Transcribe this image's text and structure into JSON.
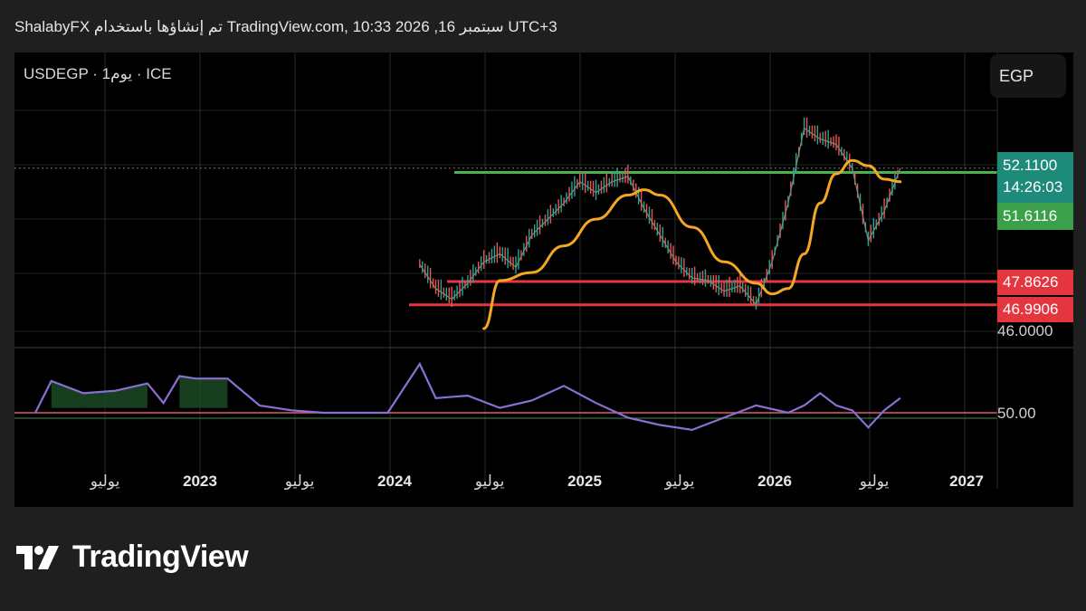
{
  "header": {
    "text": "ShalabyFX تم إنشاؤها باستخدام TradingView.com, 10:33 2026 ,16 سبتمبر UTC+3"
  },
  "symbol": {
    "text": "USDEGP · 1يوم · ICE"
  },
  "currency": {
    "label": "EGP"
  },
  "price_tags": {
    "last_price": "52.1100",
    "countdown": "14:26:03",
    "ma_value": "51.6116",
    "resistance_upper": "47.8626",
    "resistance_lower": "46.9906"
  },
  "axis": {
    "price_label_46": "46.0000",
    "osc_label_50": "50.00"
  },
  "x_ticks": [
    {
      "label": "يوليو",
      "year": false
    },
    {
      "label": "2023",
      "year": true
    },
    {
      "label": "يوليو",
      "year": false
    },
    {
      "label": "2024",
      "year": true
    },
    {
      "label": "يوليو",
      "year": false
    },
    {
      "label": "2025",
      "year": true
    },
    {
      "label": "يوليو",
      "year": false
    },
    {
      "label": "2026",
      "year": true
    },
    {
      "label": "يوليو",
      "year": false
    },
    {
      "label": "2027",
      "year": true
    }
  ],
  "brand": {
    "name": "TradingView"
  },
  "colors": {
    "up": "#26a69a",
    "down": "#ef5350",
    "ma": "#f5a623",
    "green_line": "#4caf50",
    "red_line": "#e4363f",
    "oscillator": "#8a6fd6"
  },
  "chart_data": {
    "type": "line",
    "symbol": "USDEGP",
    "timeframe": "1D",
    "x_ticks": [
      "يوليو",
      "2023",
      "يوليو",
      "2024",
      "يوليو",
      "2025",
      "يوليو",
      "2026",
      "يوليو",
      "2027"
    ],
    "price_series": {
      "x": [
        "2024-03",
        "2024-04",
        "2024-05",
        "2024-06",
        "2024-07",
        "2024-08",
        "2024-09",
        "2024-10",
        "2024-11",
        "2024-12",
        "2025-01",
        "2025-02",
        "2025-03",
        "2025-04",
        "2025-05",
        "2025-06",
        "2025-07",
        "2025-08",
        "2025-09",
        "2025-10",
        "2025-11",
        "2025-12",
        "2026-01",
        "2026-02",
        "2026-03",
        "2026-04",
        "2026-05",
        "2026-06",
        "2026-07",
        "2026-08",
        "2026-09"
      ],
      "values": [
        48.5,
        47.6,
        47.2,
        47.8,
        48.6,
        48.9,
        48.4,
        49.6,
        50.2,
        50.8,
        51.6,
        51.2,
        51.6,
        51.8,
        50.6,
        49.6,
        48.6,
        48.0,
        47.9,
        47.5,
        47.7,
        47.0,
        48.6,
        50.8,
        53.6,
        53.2,
        53.0,
        52.1,
        49.4,
        50.5,
        52.11
      ]
    },
    "moving_average": {
      "x": [
        "2024-07",
        "2024-08",
        "2024-10",
        "2024-12",
        "2025-02",
        "2025-04",
        "2025-05",
        "2025-06",
        "2025-08",
        "2025-10",
        "2025-12",
        "2026-01",
        "2026-02",
        "2026-03",
        "2026-04",
        "2026-05",
        "2026-06",
        "2026-07",
        "2026-08",
        "2026-09"
      ],
      "values": [
        46.1,
        47.9,
        48.2,
        49.2,
        50.2,
        51.1,
        51.3,
        51.1,
        49.9,
        48.6,
        47.8,
        47.4,
        47.6,
        48.9,
        50.8,
        51.9,
        52.4,
        52.2,
        51.7,
        51.6
      ]
    },
    "levels": [
      {
        "name": "green",
        "value": 51.95
      },
      {
        "name": "red-1",
        "value": 47.8626
      },
      {
        "name": "red-2",
        "value": 46.9906
      }
    ],
    "last_price": 52.11,
    "oscillator": {
      "x": [
        "2022-03",
        "2022-04",
        "2022-06",
        "2022-08",
        "2022-10",
        "2022-11",
        "2022-12",
        "2023-01",
        "2023-03",
        "2023-05",
        "2023-07",
        "2023-09",
        "2023-11",
        "2024-01",
        "2024-03",
        "2024-04",
        "2024-06",
        "2024-08",
        "2024-10",
        "2024-12",
        "2025-02",
        "2025-04",
        "2025-06",
        "2025-08",
        "2025-10",
        "2025-12",
        "2026-02",
        "2026-03",
        "2026-04",
        "2026-05",
        "2026-06",
        "2026-07",
        "2026-08",
        "2026-09"
      ],
      "values": [
        50,
        63,
        58,
        59,
        62,
        54,
        65,
        64,
        64,
        53,
        51,
        50,
        50,
        50,
        70,
        56,
        57,
        52,
        55,
        61,
        54,
        48,
        45,
        43,
        48,
        53,
        50,
        53,
        58,
        53,
        51,
        44,
        51,
        56
      ]
    },
    "oscillator_level": 50.0
  }
}
